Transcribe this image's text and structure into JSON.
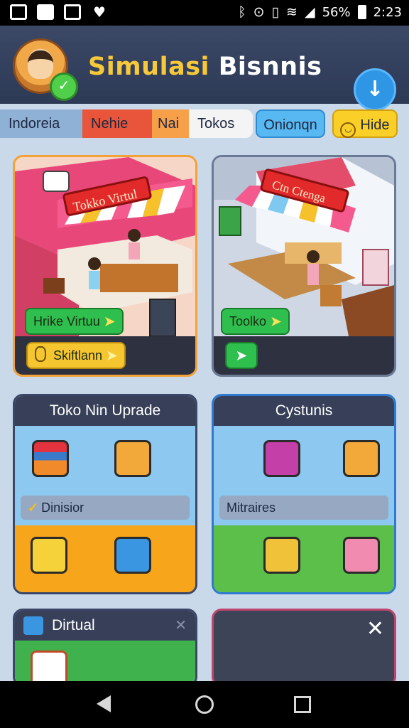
{
  "status_bar": {
    "battery": "56%",
    "time": "2:23"
  },
  "header": {
    "title_part1": "Simulasi",
    "title_part2": "Bisnnis",
    "profile_check": "✓",
    "menu_glyph": "↓"
  },
  "tabs": [
    {
      "label": "Indoreia"
    },
    {
      "label": "Nehie"
    },
    {
      "label": "Nai"
    },
    {
      "label": "Tokos"
    }
  ],
  "chips": {
    "blue": "Onionqn",
    "yellow": "Hide"
  },
  "scenes": [
    {
      "shop_sign": "Tokko Virtul",
      "tag": "Hrike Virtuu",
      "action": "Skiftlann"
    },
    {
      "shop_sign": "Ctn Ctenga",
      "tag": "Toolko",
      "action": ""
    }
  ],
  "panels": [
    {
      "title": "Toko Nin Uprade",
      "label": "Dinisior"
    },
    {
      "title": "Cystunis",
      "label": "Mitraires"
    },
    {
      "title": "Dirtual",
      "label": ""
    }
  ],
  "colors": {
    "accent": "#f7c93a",
    "fab": "#2f96e6",
    "header": "#2d3a56"
  }
}
